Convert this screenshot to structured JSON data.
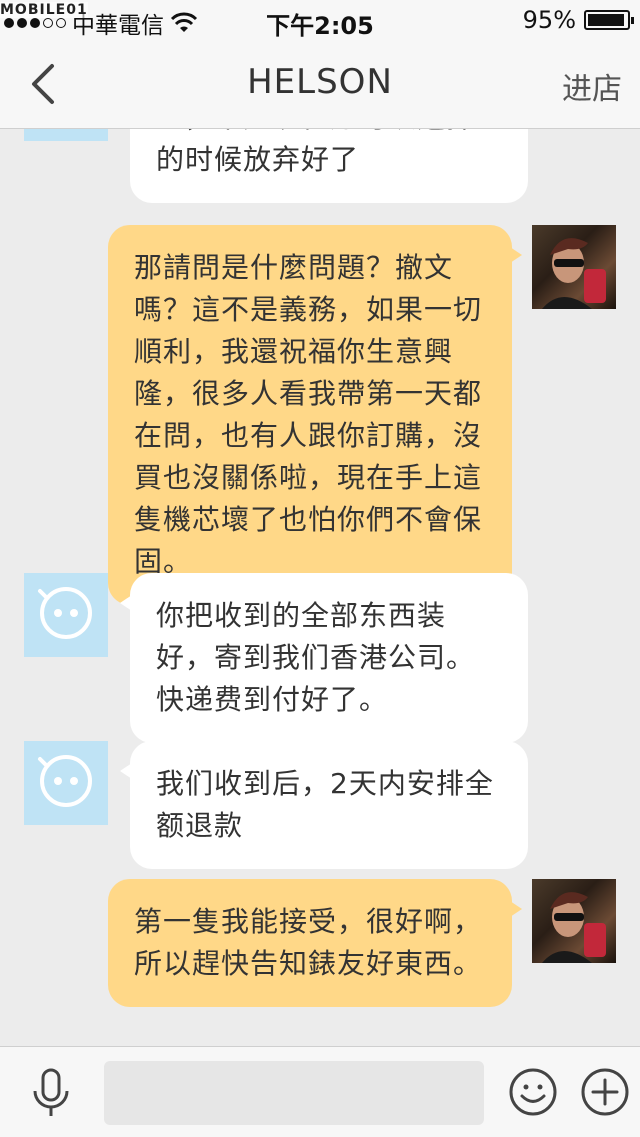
{
  "status_bar": {
    "watermark": "MOBILE01",
    "carrier": "中華電信",
    "time": "下午2:05",
    "battery": "95%",
    "battery_level": 0.95
  },
  "nav": {
    "title": "HELSON",
    "right_label": "进店"
  },
  "messages": [
    {
      "side": "in",
      "text": "心，不如现在还可以选择的时候放弃好了"
    },
    {
      "side": "out",
      "text": "那請問是什麼問題？撤文嗎？這不是義務，如果一切順利，我還祝福你生意興隆，很多人看我帶第一天都在問，也有人跟你訂購，沒買也沒關係啦，現在手上這隻機芯壞了也怕你們不會保固。"
    },
    {
      "side": "in",
      "text": "你把收到的全部东西装好，寄到我们香港公司。快递费到付好了。"
    },
    {
      "side": "in",
      "text": "我们收到后，2天内安排全额退款"
    },
    {
      "side": "out",
      "text": "第一隻我能接受，很好啊，所以趕快告知錶友好東西。"
    }
  ],
  "input": {
    "placeholder": ""
  },
  "colors": {
    "incoming": "#ffffff",
    "outgoing": "#ffd888",
    "bot_avatar": "#bfe3f5"
  },
  "icons": [
    "back-chevron-icon",
    "wifi-icon",
    "battery-icon",
    "microphone-icon",
    "emoji-icon",
    "plus-icon",
    "bot-face-icon"
  ]
}
